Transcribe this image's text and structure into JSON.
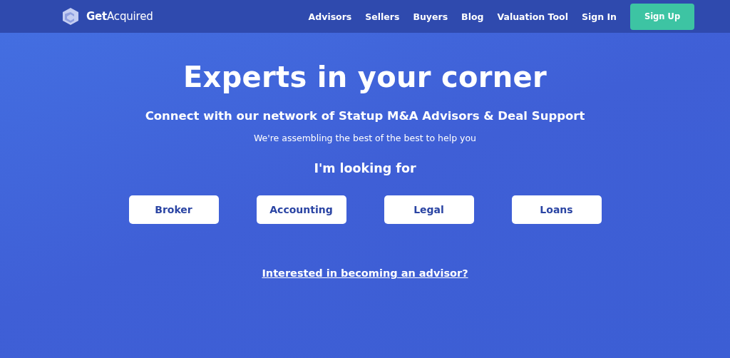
{
  "header": {
    "logo": "**Get**Acquired",
    "nav": [
      {
        "label": "Advisors"
      },
      {
        "label": "Sellers"
      },
      {
        "label": "Buyers"
      },
      {
        "label": "Blog"
      },
      {
        "label": "Valuation Tool"
      },
      {
        "label": "Sign In"
      }
    ],
    "cta": "Sign Up"
  },
  "hero": {
    "title": "Experts in your corner",
    "subtitle": "Connect with our network of Statup M&A Advisors & Deal Support",
    "note": "We're assembling the best of the best to help you",
    "prompt": "I'm looking for",
    "options": [
      {
        "label": "Broker"
      },
      {
        "label": "Accounting"
      },
      {
        "label": "Legal"
      },
      {
        "label": "Loans"
      }
    ],
    "link": "Interested in becoming an advisor?"
  }
}
